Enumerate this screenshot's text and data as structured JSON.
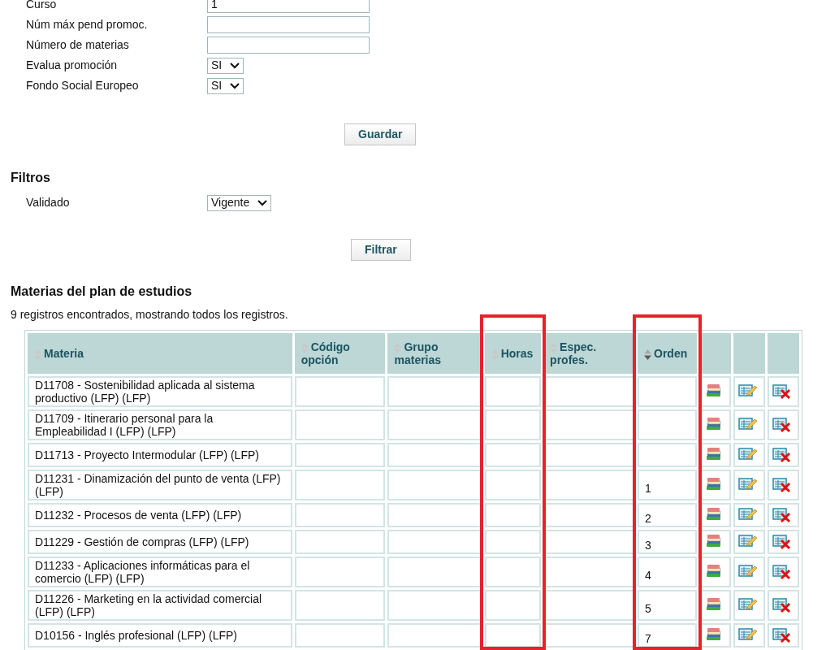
{
  "form": {
    "fields": [
      {
        "label": "Curso",
        "kind": "text",
        "value": "1"
      },
      {
        "label": "Núm máx pend promoc.",
        "kind": "text"
      },
      {
        "label": "Número de materias",
        "kind": "text"
      },
      {
        "label": "Evalua promoción",
        "kind": "select",
        "value": "SI"
      },
      {
        "label": "Fondo Social Europeo",
        "kind": "select",
        "value": "SI"
      }
    ],
    "save_button": "Guardar"
  },
  "filters": {
    "title": "Filtros",
    "fields": [
      {
        "label": "Validado",
        "kind": "select",
        "value": "Vigente"
      }
    ],
    "filter_button": "Filtrar"
  },
  "subjects": {
    "title": "Materias del plan de estudios",
    "summary": "9 registros encontrados, mostrando todos los registros.",
    "columns": [
      {
        "label": "Materia",
        "sorted": false,
        "highlighted": false
      },
      {
        "label": "Código opción",
        "sorted": false,
        "highlighted": false
      },
      {
        "label": "Grupo materias",
        "sorted": false,
        "highlighted": false
      },
      {
        "label": "Horas",
        "sorted": false,
        "highlighted": true
      },
      {
        "label": "Espec. profes.",
        "sorted": false,
        "highlighted": false
      },
      {
        "label": "Orden",
        "sorted": true,
        "highlighted": true
      }
    ],
    "rows": [
      {
        "materia": "D11708 - Sostenibilidad aplicada al sistema productivo (LFP) (LFP)"
      },
      {
        "materia": "D11709 - Itinerario personal para la Empleabilidad I (LFP) (LFP)"
      },
      {
        "materia": "D11713 - Proyecto Intermodular (LFP) (LFP)"
      },
      {
        "materia": "D11231 - Dinamización del punto de venta (LFP) (LFP)",
        "orden": "1"
      },
      {
        "materia": "D11232 - Procesos de venta (LFP) (LFP)",
        "orden": "2"
      },
      {
        "materia": "D11229 - Gestión de compras (LFP) (LFP)",
        "orden": "3"
      },
      {
        "materia": "D11233 - Aplicaciones informáticas para el comercio (LFP) (LFP)",
        "orden": "4"
      },
      {
        "materia": "D11226 - Marketing en la actividad comercial (LFP) (LFP)",
        "orden": "5"
      },
      {
        "materia": "D10156 - Inglés profesional (LFP) (LFP)",
        "orden": "7"
      }
    ]
  }
}
